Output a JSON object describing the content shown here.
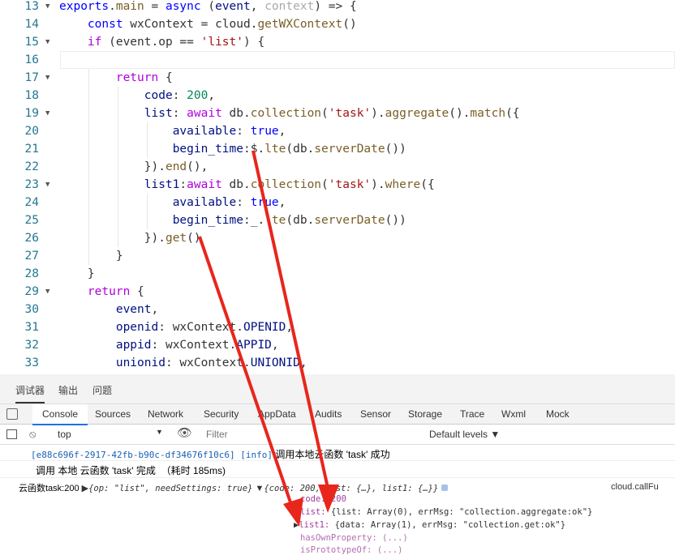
{
  "editor": {
    "lines": [
      {
        "n": "13",
        "fold": "▼",
        "html_parts": [
          [
            "kw",
            "exports"
          ],
          [
            "",
            "."
          ],
          [
            "fn",
            "main"
          ],
          [
            "",
            " = "
          ],
          [
            "kw",
            "async"
          ],
          [
            "",
            " ("
          ],
          [
            "prop",
            "event"
          ],
          [
            "",
            ", "
          ],
          [
            "dim",
            "context"
          ],
          [
            "",
            ") => {"
          ]
        ]
      },
      {
        "n": "14",
        "fold": "",
        "html_parts": [
          [
            "",
            "    "
          ],
          [
            "kw",
            "const"
          ],
          [
            "",
            " wxContext = cloud."
          ],
          [
            "fn",
            "getWXContext"
          ],
          [
            "",
            "()"
          ]
        ]
      },
      {
        "n": "15",
        "fold": "▼",
        "html_parts": [
          [
            "",
            "    "
          ],
          [
            "kw2",
            "if"
          ],
          [
            "",
            " (event.op == "
          ],
          [
            "str",
            "'list'"
          ],
          [
            "",
            ") {"
          ]
        ]
      },
      {
        "n": "16",
        "fold": "",
        "html_parts": [
          [
            "",
            ""
          ]
        ]
      },
      {
        "n": "17",
        "fold": "▼",
        "html_parts": [
          [
            "",
            "        "
          ],
          [
            "kw2",
            "return"
          ],
          [
            "",
            " {"
          ]
        ]
      },
      {
        "n": "18",
        "fold": "",
        "html_parts": [
          [
            "",
            "            "
          ],
          [
            "prop",
            "code"
          ],
          [
            "",
            ": "
          ],
          [
            "num",
            "200"
          ],
          [
            "",
            ","
          ]
        ]
      },
      {
        "n": "19",
        "fold": "▼",
        "html_parts": [
          [
            "",
            "            "
          ],
          [
            "prop",
            "list"
          ],
          [
            "",
            ": "
          ],
          [
            "kw2",
            "await"
          ],
          [
            "",
            " db."
          ],
          [
            "fn",
            "collection"
          ],
          [
            "",
            "("
          ],
          [
            "str",
            "'task'"
          ],
          [
            "",
            ")."
          ],
          [
            "fn",
            "aggregate"
          ],
          [
            "",
            "()."
          ],
          [
            "fn",
            "match"
          ],
          [
            "",
            "({"
          ]
        ]
      },
      {
        "n": "20",
        "fold": "",
        "html_parts": [
          [
            "",
            "                "
          ],
          [
            "prop",
            "available"
          ],
          [
            "",
            ": "
          ],
          [
            "kw",
            "true"
          ],
          [
            "",
            ","
          ]
        ]
      },
      {
        "n": "21",
        "fold": "",
        "html_parts": [
          [
            "",
            "                "
          ],
          [
            "prop",
            "begin_time"
          ],
          [
            "",
            ":$."
          ],
          [
            "fn",
            "lte"
          ],
          [
            "",
            "(db."
          ],
          [
            "fn",
            "serverDate"
          ],
          [
            "",
            "())"
          ]
        ]
      },
      {
        "n": "22",
        "fold": "",
        "html_parts": [
          [
            "",
            "            "
          ],
          [
            "",
            "})."
          ],
          [
            "fn",
            "end"
          ],
          [
            "",
            "(),"
          ]
        ]
      },
      {
        "n": "23",
        "fold": "▼",
        "html_parts": [
          [
            "",
            "            "
          ],
          [
            "prop",
            "list1"
          ],
          [
            "",
            ":"
          ],
          [
            "kw2",
            "await"
          ],
          [
            "",
            " db."
          ],
          [
            "fn",
            "collection"
          ],
          [
            "",
            "("
          ],
          [
            "str",
            "'task'"
          ],
          [
            "",
            ")."
          ],
          [
            "fn",
            "where"
          ],
          [
            "",
            "({"
          ]
        ]
      },
      {
        "n": "24",
        "fold": "",
        "html_parts": [
          [
            "",
            "                "
          ],
          [
            "prop",
            "available"
          ],
          [
            "",
            ": "
          ],
          [
            "kw",
            "true"
          ],
          [
            "",
            ","
          ]
        ]
      },
      {
        "n": "25",
        "fold": "",
        "html_parts": [
          [
            "",
            "                "
          ],
          [
            "prop",
            "begin_time"
          ],
          [
            "",
            ":_."
          ],
          [
            "fn",
            "lte"
          ],
          [
            "",
            "(db."
          ],
          [
            "fn",
            "serverDate"
          ],
          [
            "",
            "())"
          ]
        ]
      },
      {
        "n": "26",
        "fold": "",
        "html_parts": [
          [
            "",
            "            "
          ],
          [
            "",
            "})."
          ],
          [
            "fn",
            "get"
          ],
          [
            "",
            "()"
          ]
        ]
      },
      {
        "n": "27",
        "fold": "",
        "html_parts": [
          [
            "",
            "        "
          ],
          [
            "",
            "}"
          ]
        ]
      },
      {
        "n": "28",
        "fold": "",
        "html_parts": [
          [
            "",
            "    "
          ],
          [
            "",
            "}"
          ]
        ]
      },
      {
        "n": "29",
        "fold": "▼",
        "html_parts": [
          [
            "",
            "    "
          ],
          [
            "kw2",
            "return"
          ],
          [
            "",
            " {"
          ]
        ]
      },
      {
        "n": "30",
        "fold": "",
        "html_parts": [
          [
            "",
            "        "
          ],
          [
            "prop",
            "event"
          ],
          [
            "",
            ","
          ]
        ]
      },
      {
        "n": "31",
        "fold": "",
        "html_parts": [
          [
            "",
            "        "
          ],
          [
            "prop",
            "openid"
          ],
          [
            "",
            ": wxContext."
          ],
          [
            "prop",
            "OPENID"
          ],
          [
            "",
            ","
          ]
        ]
      },
      {
        "n": "32",
        "fold": "",
        "html_parts": [
          [
            "",
            "        "
          ],
          [
            "prop",
            "appid"
          ],
          [
            "",
            ": wxContext."
          ],
          [
            "prop",
            "APPID"
          ],
          [
            "",
            ","
          ]
        ]
      },
      {
        "n": "33",
        "fold": "",
        "html_parts": [
          [
            "",
            "        "
          ],
          [
            "prop",
            "unionid"
          ],
          [
            "",
            ": wxContext."
          ],
          [
            "prop",
            "UNIONID"
          ],
          [
            "",
            ","
          ]
        ]
      }
    ]
  },
  "devtools": {
    "top_tabs": [
      "调试器",
      "输出",
      "问题"
    ],
    "panel_tabs": [
      "Console",
      "Sources",
      "Network",
      "Security",
      "AppData",
      "Audits",
      "Sensor",
      "Storage",
      "Trace",
      "Wxml",
      "Mock"
    ],
    "toolbar": {
      "context": "top",
      "filter_placeholder": "Filter",
      "levels": "Default levels ▼"
    },
    "console": {
      "line1_id": "[e88c696f-2917-42fb-b90c-df34676f10c6] [info]",
      "line1_msg": " 调用本地云函数 'task' 成功",
      "line2": "调用 本地 云函数 'task' 完成  （耗时 185ms)",
      "line3_label": "云函数task:200",
      "line3_arg": "{op: \"list\", needSettings: true}",
      "line3_result": "{code: 200, list: {…}, list1: {…}}",
      "line3_source": "cloud.callFu",
      "obj_code": "code: 200",
      "obj_list_key": "list: ",
      "obj_list_val": "{list: Array(0), errMsg: \"collection.aggregate:ok\"}",
      "obj_list1_key": "list1: ",
      "obj_list1_val": "{data: Array(1), errMsg: \"collection.get:ok\"}",
      "obj_has": "hasOwnProperty: (...)",
      "obj_next": "isPrototypeOf: (...)"
    }
  },
  "colors": {
    "arrow": "#e8261c",
    "accent": "#1a73e8"
  }
}
